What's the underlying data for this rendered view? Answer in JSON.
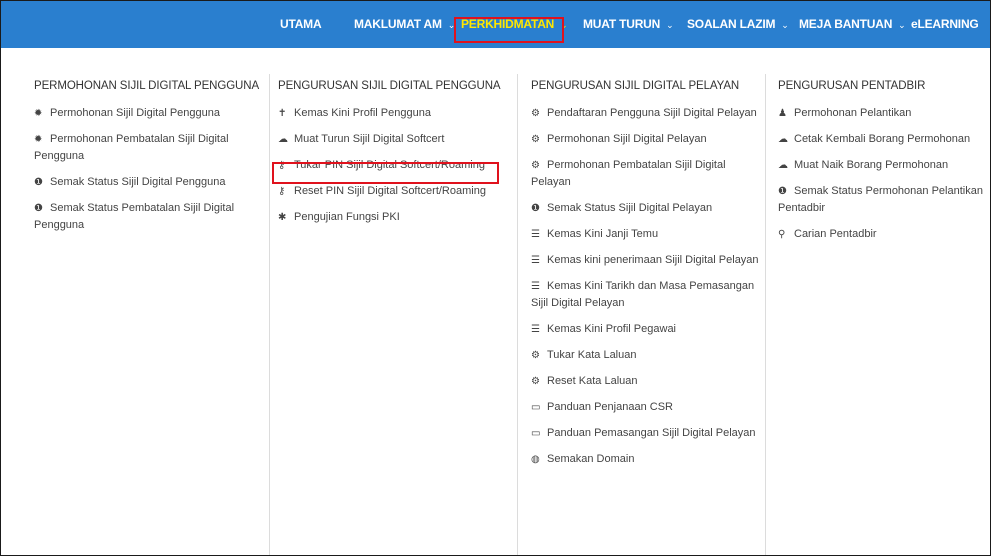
{
  "nav": {
    "items": [
      {
        "label": "UTAMA",
        "chevron": ""
      },
      {
        "label": "MAKLUMAT AM",
        "chevron": "⌄"
      },
      {
        "label": "PERKHIDMATAN",
        "chevron": "⌄"
      },
      {
        "label": "MUAT TURUN",
        "chevron": "⌄"
      },
      {
        "label": "SOALAN LAZIM",
        "chevron": "⌄"
      },
      {
        "label": "MEJA BANTUAN",
        "chevron": "⌄"
      },
      {
        "label": "eLEARNING",
        "chevron": ""
      }
    ],
    "active_color": "#ffe600",
    "bar_color": "#2a7fcf"
  },
  "columns": [
    {
      "heading": "PERMOHONAN SIJIL DIGITAL PENGGUNA",
      "links": [
        {
          "icon": "✹",
          "icon_name": "certificate-icon",
          "label": "Permohonan Sijil Digital Pengguna"
        },
        {
          "icon": "✹",
          "icon_name": "certificate-icon",
          "label": "Permohonan Pembatalan Sijil Digital Pengguna"
        },
        {
          "icon": "❶",
          "icon_name": "info-icon",
          "label": "Semak Status Sijil Digital Pengguna"
        },
        {
          "icon": "❶",
          "icon_name": "info-icon",
          "label": "Semak Status Pembatalan Sijil Digital Pengguna"
        }
      ]
    },
    {
      "heading": "PENGURUSAN SIJIL DIGITAL PENGGUNA",
      "links": [
        {
          "icon": "✝",
          "icon_name": "user-profile-icon",
          "label": "Kemas Kini Profil Pengguna"
        },
        {
          "icon": "☁",
          "icon_name": "cloud-download-icon",
          "label": "Muat Turun Sijil Digital Softcert"
        },
        {
          "icon": "⚷",
          "icon_name": "key-icon",
          "label": "Tukar PIN Sijil Digital Softcert/Roaming"
        },
        {
          "icon": "⚷",
          "icon_name": "key-icon",
          "label": "Reset PIN Sijil Digital Softcert/Roaming"
        },
        {
          "icon": "✱",
          "icon_name": "asterisk-icon",
          "label": "Pengujian Fungsi PKI"
        }
      ]
    },
    {
      "heading": "PENGURUSAN SIJIL DIGITAL PELAYAN",
      "links": [
        {
          "icon": "⚙",
          "icon_name": "server-icon",
          "label": "Pendaftaran Pengguna Sijil Digital Pelayan"
        },
        {
          "icon": "⚙",
          "icon_name": "server-icon",
          "label": "Permohonan Sijil Digital Pelayan"
        },
        {
          "icon": "⚙",
          "icon_name": "server-icon",
          "label": "Permohonan Pembatalan Sijil Digital Pelayan"
        },
        {
          "icon": "❶",
          "icon_name": "info-icon",
          "label": "Semak Status Sijil Digital Pelayan"
        },
        {
          "icon": "☰",
          "icon_name": "list-icon",
          "label": "Kemas Kini Janji Temu"
        },
        {
          "icon": "☰",
          "icon_name": "list-icon",
          "label": "Kemas kini penerimaan Sijil Digital Pelayan"
        },
        {
          "icon": "☰",
          "icon_name": "list-icon",
          "label": "Kemas Kini Tarikh dan Masa Pemasangan Sijil Digital Pelayan"
        },
        {
          "icon": "☰",
          "icon_name": "list-icon",
          "label": "Kemas Kini Profil Pegawai"
        },
        {
          "icon": "⚙",
          "icon_name": "lock-icon",
          "label": "Tukar Kata Laluan"
        },
        {
          "icon": "⚙",
          "icon_name": "lock-icon",
          "label": "Reset Kata Laluan"
        },
        {
          "icon": "▭",
          "icon_name": "guide-icon",
          "label": "Panduan Penjanaan CSR"
        },
        {
          "icon": "▭",
          "icon_name": "guide-icon",
          "label": "Panduan Pemasangan Sijil Digital Pelayan"
        },
        {
          "icon": "◍",
          "icon_name": "globe-icon",
          "label": "Semakan Domain"
        }
      ]
    },
    {
      "heading": "PENGURUSAN PENTADBIR",
      "links": [
        {
          "icon": "♟",
          "icon_name": "user-icon",
          "label": "Permohonan Pelantikan"
        },
        {
          "icon": "☁",
          "icon_name": "cloud-icon",
          "label": "Cetak Kembali Borang Permohonan"
        },
        {
          "icon": "☁",
          "icon_name": "cloud-upload-icon",
          "label": "Muat Naik Borang Permohonan"
        },
        {
          "icon": "❶",
          "icon_name": "info-icon",
          "label": "Semak Status Permohonan Pelantikan Pentadbir"
        },
        {
          "icon": "⚲",
          "icon_name": "search-icon",
          "label": "Carian Pentadbir"
        }
      ]
    }
  ]
}
